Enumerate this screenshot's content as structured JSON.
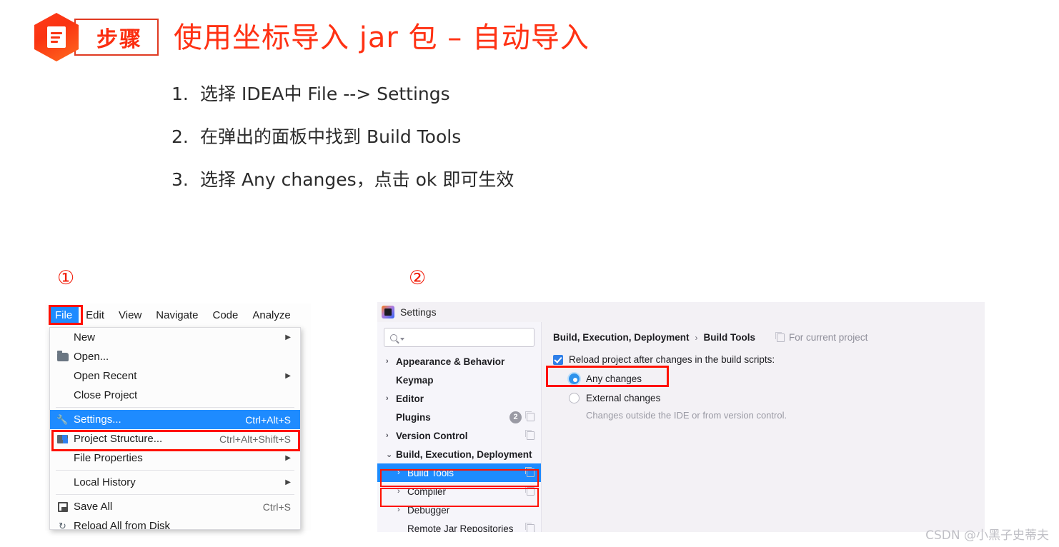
{
  "header": {
    "badge_label": "步骤",
    "badge_icon": "document-icon",
    "title": "使用坐标导入 jar 包 – 自动导入",
    "title_color": "#ff3214"
  },
  "steps": [
    {
      "num": "1.",
      "text": "选择 IDEA中 File --> Settings"
    },
    {
      "num": "2.",
      "text": "在弹出的面板中找到 Build Tools"
    },
    {
      "num": "3.",
      "text": "选择 Any changes，点击 ok 即可生效"
    }
  ],
  "markers": {
    "one": "①",
    "two": "②"
  },
  "menu_screenshot": {
    "menubar": [
      {
        "label": "File",
        "underline": "F",
        "active": true
      },
      {
        "label": "Edit",
        "underline": "E",
        "active": false
      },
      {
        "label": "View",
        "underline": "V",
        "active": false
      },
      {
        "label": "Navigate",
        "underline": "N",
        "active": false
      },
      {
        "label": "Code",
        "underline": "C",
        "active": false
      },
      {
        "label": "Analyze",
        "underline": "z",
        "active": false
      }
    ],
    "items": [
      {
        "label": "New",
        "shortcut": "",
        "arrow": true,
        "icon": "",
        "selected": false
      },
      {
        "label": "Open...",
        "shortcut": "",
        "arrow": false,
        "icon": "folder-icon",
        "selected": false
      },
      {
        "label": "Open Recent",
        "shortcut": "",
        "arrow": true,
        "icon": "",
        "selected": false
      },
      {
        "label": "Close Project",
        "shortcut": "",
        "arrow": false,
        "icon": "",
        "selected": false
      },
      {
        "label": "Settings...",
        "shortcut": "Ctrl+Alt+S",
        "arrow": false,
        "icon": "wrench-icon",
        "selected": true
      },
      {
        "label": "Project Structure...",
        "shortcut": "Ctrl+Alt+Shift+S",
        "arrow": false,
        "icon": "project-structure-icon",
        "selected": false
      },
      {
        "label": "File Properties",
        "shortcut": "",
        "arrow": true,
        "icon": "",
        "selected": false
      },
      {
        "label": "Local History",
        "shortcut": "",
        "arrow": true,
        "icon": "",
        "selected": false
      },
      {
        "label": "Save All",
        "shortcut": "Ctrl+S",
        "arrow": false,
        "icon": "floppy-icon",
        "selected": false
      },
      {
        "label": "Reload All from Disk",
        "shortcut": "",
        "arrow": false,
        "icon": "reload-icon",
        "selected": false
      }
    ]
  },
  "settings_dialog": {
    "window_title": "Settings",
    "window_icon": "intellij-idea-logo",
    "search_placeholder": "",
    "search_value": "",
    "tree": [
      {
        "label": "Appearance & Behavior",
        "chev": "›",
        "bold": true,
        "indent": false,
        "badge": "",
        "copy": false,
        "selected": false
      },
      {
        "label": "Keymap",
        "chev": "",
        "bold": true,
        "indent": false,
        "badge": "",
        "copy": false,
        "selected": false
      },
      {
        "label": "Editor",
        "chev": "›",
        "bold": true,
        "indent": false,
        "badge": "",
        "copy": false,
        "selected": false
      },
      {
        "label": "Plugins",
        "chev": "",
        "bold": true,
        "indent": false,
        "badge": "2",
        "copy": true,
        "selected": false
      },
      {
        "label": "Version Control",
        "chev": "›",
        "bold": true,
        "indent": false,
        "badge": "",
        "copy": true,
        "selected": false
      },
      {
        "label": "Build, Execution, Deployment",
        "chev": "⌄",
        "bold": true,
        "indent": false,
        "badge": "",
        "copy": false,
        "selected": false
      },
      {
        "label": "Build Tools",
        "chev": "›",
        "bold": false,
        "indent": true,
        "badge": "",
        "copy": true,
        "selected": true
      },
      {
        "label": "Compiler",
        "chev": "›",
        "bold": false,
        "indent": true,
        "badge": "",
        "copy": true,
        "selected": false
      },
      {
        "label": "Debugger",
        "chev": "›",
        "bold": false,
        "indent": true,
        "badge": "",
        "copy": false,
        "selected": false
      },
      {
        "label": "Remote Jar Repositories",
        "chev": "",
        "bold": false,
        "indent": true,
        "badge": "",
        "copy": true,
        "selected": false
      }
    ],
    "breadcrumb": {
      "root": "Build, Execution, Deployment",
      "separator": "›",
      "leaf": "Build Tools",
      "scope_label": "For current project",
      "scope_icon": "copy-icon"
    },
    "checkbox": {
      "label": "Reload project after changes in the build scripts:",
      "checked": true
    },
    "radios": [
      {
        "label": "Any changes",
        "selected": true
      },
      {
        "label": "External changes",
        "selected": false
      }
    ],
    "hint": "Changes outside the IDE or from version control."
  },
  "watermark": "CSDN @小黑子史蒂夫",
  "colors": {
    "accent_red": "#ff1100",
    "select_blue": "#1e8bff",
    "title_red": "#ff3214"
  }
}
